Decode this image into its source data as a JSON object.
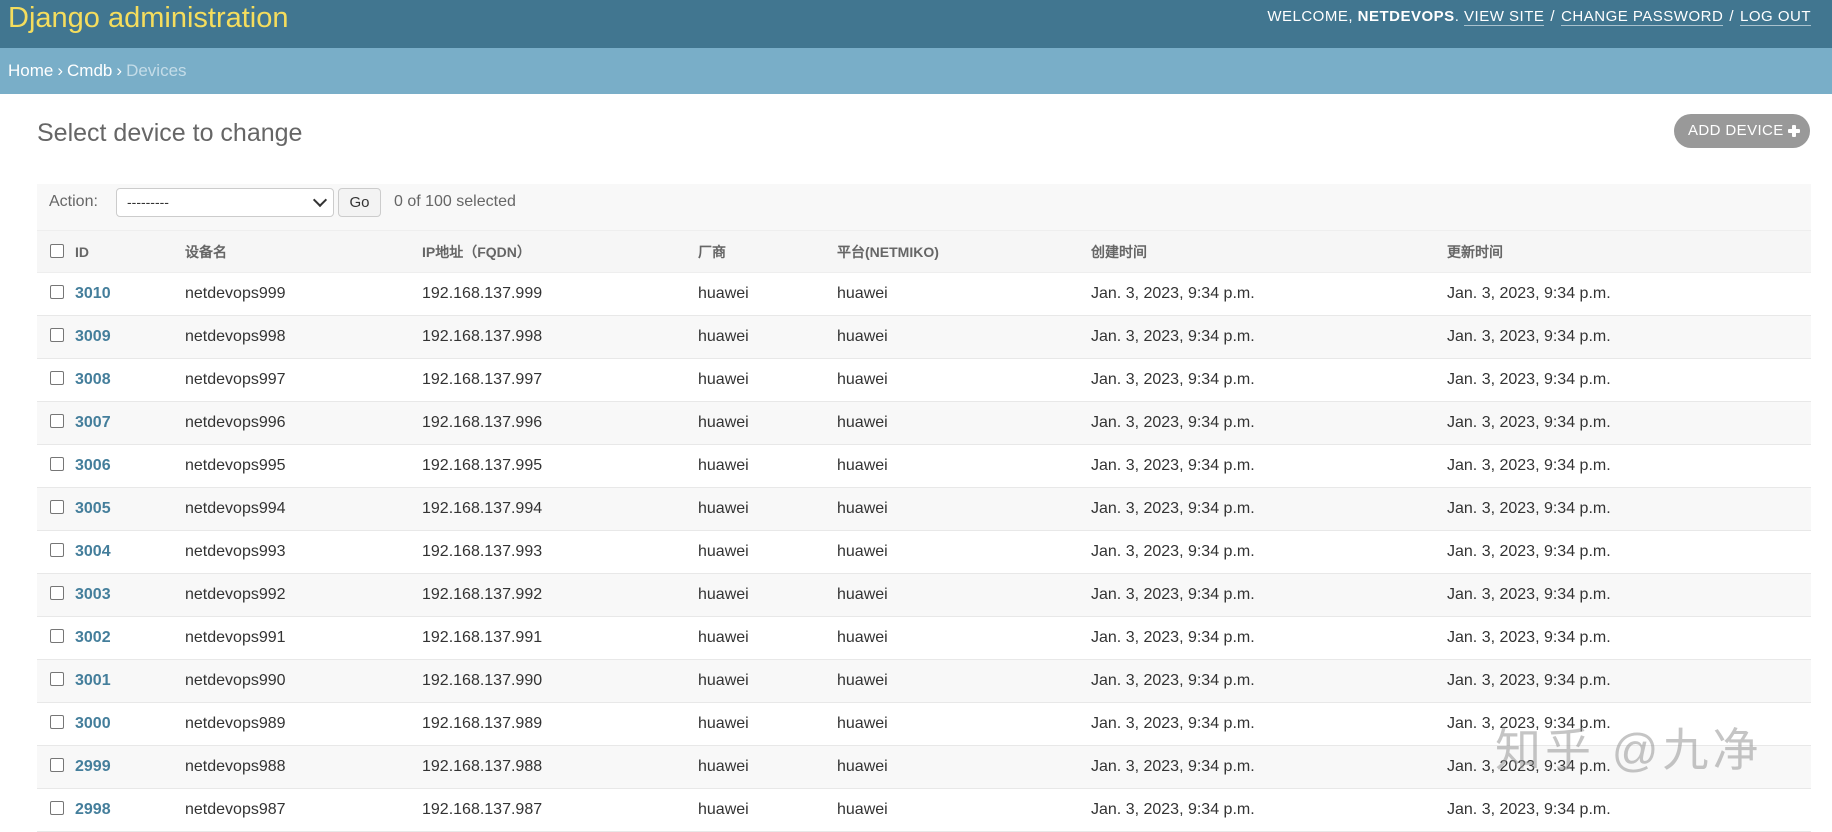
{
  "header": {
    "site_name": "Django administration",
    "welcome": "WELCOME,",
    "username": "NETDEVOPS",
    "view_site": "VIEW SITE",
    "change_password": "CHANGE PASSWORD",
    "log_out": "LOG OUT"
  },
  "breadcrumbs": {
    "home": "Home",
    "app": "Cmdb",
    "current": "Devices"
  },
  "content": {
    "title": "Select device to change",
    "add_button": "ADD DEVICE"
  },
  "actions": {
    "label": "Action:",
    "selected_option": "---------",
    "go": "Go",
    "counter": "0 of 100 selected"
  },
  "table": {
    "headers": [
      "ID",
      "设备名",
      "IP地址（FQDN）",
      "厂商",
      "平台(NETMIKO)",
      "创建时间",
      "更新时间"
    ],
    "rows": [
      {
        "id": "3010",
        "name": "netdevops999",
        "ip": "192.168.137.999",
        "vendor": "huawei",
        "platform": "huawei",
        "created": "Jan. 3, 2023, 9:34 p.m.",
        "updated": "Jan. 3, 2023, 9:34 p.m."
      },
      {
        "id": "3009",
        "name": "netdevops998",
        "ip": "192.168.137.998",
        "vendor": "huawei",
        "platform": "huawei",
        "created": "Jan. 3, 2023, 9:34 p.m.",
        "updated": "Jan. 3, 2023, 9:34 p.m."
      },
      {
        "id": "3008",
        "name": "netdevops997",
        "ip": "192.168.137.997",
        "vendor": "huawei",
        "platform": "huawei",
        "created": "Jan. 3, 2023, 9:34 p.m.",
        "updated": "Jan. 3, 2023, 9:34 p.m."
      },
      {
        "id": "3007",
        "name": "netdevops996",
        "ip": "192.168.137.996",
        "vendor": "huawei",
        "platform": "huawei",
        "created": "Jan. 3, 2023, 9:34 p.m.",
        "updated": "Jan. 3, 2023, 9:34 p.m."
      },
      {
        "id": "3006",
        "name": "netdevops995",
        "ip": "192.168.137.995",
        "vendor": "huawei",
        "platform": "huawei",
        "created": "Jan. 3, 2023, 9:34 p.m.",
        "updated": "Jan. 3, 2023, 9:34 p.m."
      },
      {
        "id": "3005",
        "name": "netdevops994",
        "ip": "192.168.137.994",
        "vendor": "huawei",
        "platform": "huawei",
        "created": "Jan. 3, 2023, 9:34 p.m.",
        "updated": "Jan. 3, 2023, 9:34 p.m."
      },
      {
        "id": "3004",
        "name": "netdevops993",
        "ip": "192.168.137.993",
        "vendor": "huawei",
        "platform": "huawei",
        "created": "Jan. 3, 2023, 9:34 p.m.",
        "updated": "Jan. 3, 2023, 9:34 p.m."
      },
      {
        "id": "3003",
        "name": "netdevops992",
        "ip": "192.168.137.992",
        "vendor": "huawei",
        "platform": "huawei",
        "created": "Jan. 3, 2023, 9:34 p.m.",
        "updated": "Jan. 3, 2023, 9:34 p.m."
      },
      {
        "id": "3002",
        "name": "netdevops991",
        "ip": "192.168.137.991",
        "vendor": "huawei",
        "platform": "huawei",
        "created": "Jan. 3, 2023, 9:34 p.m.",
        "updated": "Jan. 3, 2023, 9:34 p.m."
      },
      {
        "id": "3001",
        "name": "netdevops990",
        "ip": "192.168.137.990",
        "vendor": "huawei",
        "platform": "huawei",
        "created": "Jan. 3, 2023, 9:34 p.m.",
        "updated": "Jan. 3, 2023, 9:34 p.m."
      },
      {
        "id": "3000",
        "name": "netdevops989",
        "ip": "192.168.137.989",
        "vendor": "huawei",
        "platform": "huawei",
        "created": "Jan. 3, 2023, 9:34 p.m.",
        "updated": "Jan. 3, 2023, 9:34 p.m."
      },
      {
        "id": "2999",
        "name": "netdevops988",
        "ip": "192.168.137.988",
        "vendor": "huawei",
        "platform": "huawei",
        "created": "Jan. 3, 2023, 9:34 p.m.",
        "updated": "Jan. 3, 2023, 9:34 p.m."
      },
      {
        "id": "2998",
        "name": "netdevops987",
        "ip": "192.168.137.987",
        "vendor": "huawei",
        "platform": "huawei",
        "created": "Jan. 3, 2023, 9:34 p.m.",
        "updated": "Jan. 3, 2023, 9:34 p.m."
      }
    ]
  },
  "watermark": "知乎 @九净",
  "colors": {
    "header_bg": "#417690",
    "site_name": "#f5dd5d",
    "breadcrumbs_bg": "#79aec8",
    "link": "#447e9b",
    "add_button_bg": "#999999"
  }
}
